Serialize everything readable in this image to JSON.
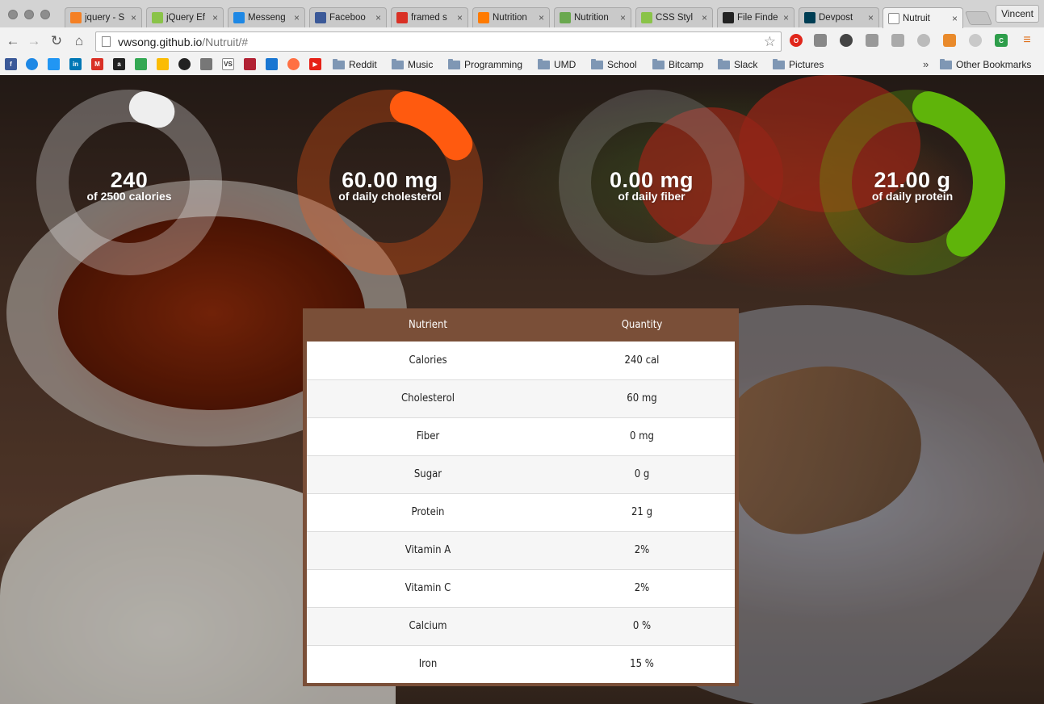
{
  "browser": {
    "tabs": [
      {
        "label": "jquery - S",
        "icon": "stackoverflow-icon",
        "color": "#f48024"
      },
      {
        "label": "jQuery Ef",
        "icon": "w3schools-icon",
        "color": "#8ac349"
      },
      {
        "label": "Messeng",
        "icon": "messenger-icon",
        "color": "#1e88e5"
      },
      {
        "label": "Faceboo",
        "icon": "facebook-icon",
        "color": "#3b5998"
      },
      {
        "label": "framed s",
        "icon": "gmail-icon",
        "color": "#d93025"
      },
      {
        "label": "Nutrition",
        "icon": "nutritionix-icon",
        "color": "#ff7a00"
      },
      {
        "label": "Nutrition",
        "icon": "calculator-icon",
        "color": "#6aa84f"
      },
      {
        "label": "CSS Styl",
        "icon": "w3schools-icon",
        "color": "#8ac349"
      },
      {
        "label": "File Finde",
        "icon": "github-icon",
        "color": "#222222"
      },
      {
        "label": "Devpost",
        "icon": "devpost-icon",
        "color": "#003e54"
      },
      {
        "label": "Nutruit",
        "icon": "page-icon",
        "color": "#ffffff"
      }
    ],
    "profile": "Vincent",
    "url_host": "vwsong.github.io",
    "url_path": "/Nutruit/#",
    "bookmark_folders": [
      "Reddit",
      "Music",
      "Programming",
      "UMD",
      "School",
      "Bitcamp",
      "Slack",
      "Pictures"
    ],
    "other_bookmarks": "Other Bookmarks",
    "overflow": "»"
  },
  "gauges": [
    {
      "value": "240",
      "label": "of 2500 calories",
      "color": "#eeeeee",
      "fraction": 0.096
    },
    {
      "value": "60.00 mg",
      "label": "of daily cholesterol",
      "color": "#ff5a0f",
      "fraction": 0.2
    },
    {
      "value": "0.00 mg",
      "label": "of daily fiber",
      "color": "#999999",
      "fraction": 0
    },
    {
      "value": "21.00 g",
      "label": "of daily protein",
      "color": "#5fb40a",
      "fraction": 0.42
    }
  ],
  "table": {
    "headers": [
      "Nutrient",
      "Quantity"
    ],
    "rows": [
      [
        "Calories",
        "240 cal"
      ],
      [
        "Cholesterol",
        "60 mg"
      ],
      [
        "Fiber",
        "0 mg"
      ],
      [
        "Sugar",
        "0 g"
      ],
      [
        "Protein",
        "21 g"
      ],
      [
        "Vitamin A",
        "2%"
      ],
      [
        "Vitamin C",
        "2%"
      ],
      [
        "Calcium",
        "0 %"
      ],
      [
        "Iron",
        "15 %"
      ]
    ]
  }
}
